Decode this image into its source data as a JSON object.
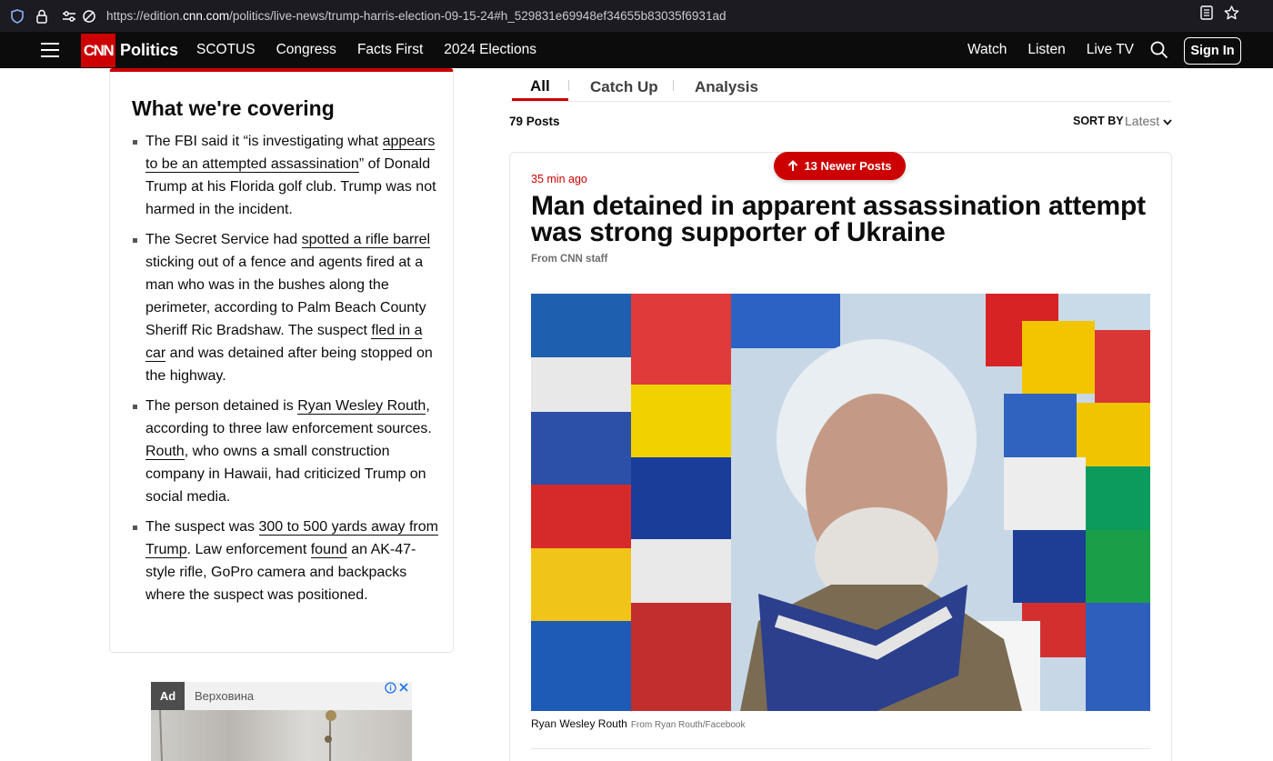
{
  "browser": {
    "url_prefix": "https://edition.",
    "url_domain": "cnn.com",
    "url_rest": "/politics/live-news/trump-harris-election-09-15-24#h_529831e69948ef34655b83035f6931ad"
  },
  "nav": {
    "logo": "CNN",
    "section": "Politics",
    "links": [
      "SCOTUS",
      "Congress",
      "Facts First",
      "2024 Elections"
    ],
    "right_links": [
      "Watch",
      "Listen",
      "Live TV"
    ],
    "sign_in": "Sign In"
  },
  "covering": {
    "title": "What we're covering",
    "items": [
      {
        "parts": [
          {
            "text": "The FBI said it “is investigating what "
          },
          {
            "text": "appears to be an attempted assassination",
            "link": true
          },
          {
            "text": "” of Donald Trump at his Florida golf club. Trump was not harmed in the incident."
          }
        ]
      },
      {
        "parts": [
          {
            "text": "The Secret Service had "
          },
          {
            "text": "spotted a rifle barrel",
            "link": true
          },
          {
            "text": " sticking out of a fence and agents fired at a man who was in the bushes along the perimeter, according to Palm Beach County Sheriff Ric Bradshaw. The suspect "
          },
          {
            "text": "fled in a car",
            "link": true
          },
          {
            "text": " and was detained after being stopped on the highway."
          }
        ]
      },
      {
        "parts": [
          {
            "text": "The person detained is "
          },
          {
            "text": "Ryan Wesley Routh",
            "link": true
          },
          {
            "text": ", according to three law enforcement sources. "
          },
          {
            "text": "Routh",
            "link": true
          },
          {
            "text": ", who owns a small construction company in Hawaii, had criticized Trump on social media."
          }
        ]
      },
      {
        "parts": [
          {
            "text": "The suspect was "
          },
          {
            "text": "300 to 500 yards away from Trump",
            "link": true
          },
          {
            "text": ". Law enforcement "
          },
          {
            "text": "found",
            "link": true
          },
          {
            "text": " an AK-47-style rifle, GoPro camera and backpacks where the suspect was positioned."
          }
        ]
      }
    ]
  },
  "ad": {
    "tag": "Ad",
    "name": "Верховина",
    "info_icon": "info-icon",
    "close_icon": "close-icon"
  },
  "tabs": [
    {
      "label": "All",
      "active": true
    },
    {
      "label": "Catch Up",
      "active": false
    },
    {
      "label": "Analysis",
      "active": false
    }
  ],
  "feed": {
    "posts_count": "79 Posts",
    "sort_label": "SORT BY",
    "sort_value": "Latest",
    "newer_posts": "13 Newer Posts"
  },
  "post": {
    "time": "35 min ago",
    "headline": "Man detained in apparent assassination attempt was strong supporter of Ukraine",
    "byline": "From CNN staff",
    "photo_alt": "Ryan Wesley Routh",
    "caption": "Ryan Wesley Routh",
    "caption_source": "From Ryan Routh/Facebook"
  },
  "colors": {
    "cnn_red": "#cc0000",
    "nav_bg": "#0c0c0c",
    "chrome_bg": "#1c1b22"
  }
}
